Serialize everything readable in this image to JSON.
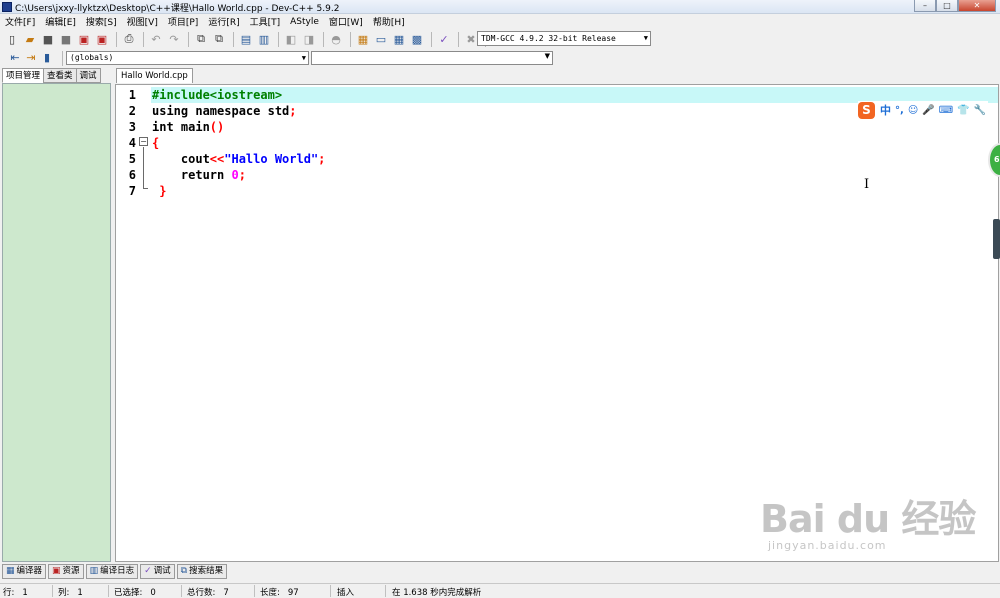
{
  "window": {
    "title": "C:\\Users\\jxxy-llyktzx\\Desktop\\C++课程\\Hallo World.cpp - Dev-C++ 5.9.2",
    "controls": [
      "–",
      "□",
      "✕"
    ]
  },
  "menu": [
    "文件[F]",
    "编辑[E]",
    "搜索[S]",
    "视图[V]",
    "项目[P]",
    "运行[R]",
    "工具[T]",
    "AStyle",
    "窗口[W]",
    "帮助[H]"
  ],
  "toolbar": {
    "compiler": "TDM-GCC 4.9.2 32-bit Release",
    "scope": "(globals)",
    "function": ""
  },
  "left_panel": {
    "tabs": [
      "项目管理",
      "查看类",
      "调试"
    ]
  },
  "editor": {
    "file_tab": "Hallo World.cpp",
    "line_numbers": [
      "1",
      "2",
      "3",
      "4",
      "5",
      "6",
      "7"
    ],
    "code": {
      "l1_pp": "#include<iostream>",
      "l2_kw": "using namespace std",
      "l2_semi": ";",
      "l3_kw": "int main",
      "l3_paren": "()",
      "l4_brace": "{",
      "l5_indent": "    cout",
      "l5_op": "<<",
      "l5_str": "\"Hallo World\"",
      "l5_semi": ";",
      "l6_kw": "    return ",
      "l6_num": "0",
      "l6_semi": ";",
      "l7_brace": " }"
    },
    "fold_marker": "−"
  },
  "ime": {
    "logo": "S",
    "items": [
      "中",
      "°,",
      "☺",
      "🎤",
      "⌨",
      "👕",
      "🔧"
    ]
  },
  "overlay": {
    "green_ball": "66",
    "cursor": "I",
    "watermark_main": "Bai du 经验",
    "watermark_sub": "jingyan.baidu.com"
  },
  "bottom_tabs": [
    {
      "icon": "compiler-icon",
      "label": "编译器"
    },
    {
      "icon": "resource-icon",
      "label": "资源"
    },
    {
      "icon": "chart-icon",
      "label": "编译日志"
    },
    {
      "icon": "check-icon",
      "label": "调试"
    },
    {
      "icon": "search-results-icon",
      "label": "搜索结果"
    }
  ],
  "status": {
    "row_label": "行:",
    "row_value": "1",
    "col_label": "列:",
    "col_value": "1",
    "sel_label": "已选择:",
    "sel_value": "0",
    "total_label": "总行数:",
    "total_value": "7",
    "len_label": "长度:",
    "len_value": "97",
    "mode": "插入",
    "parse_msg": "在 1.638 秒内完成解析"
  }
}
